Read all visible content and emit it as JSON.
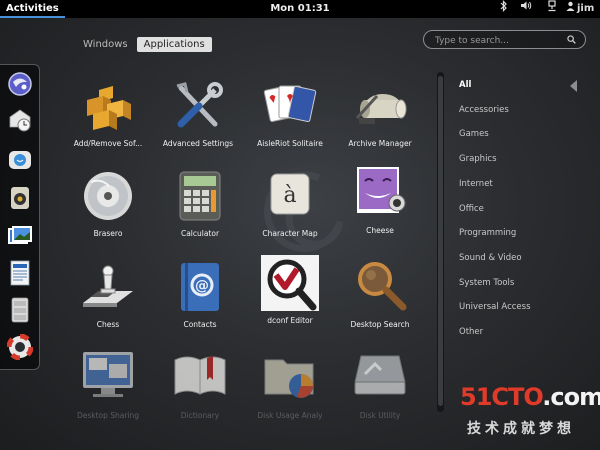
{
  "topbar": {
    "activities_label": "Activities",
    "clock": "Mon 01:31",
    "user": "jim",
    "icons": [
      "bluetooth-icon",
      "volume-icon",
      "network-icon",
      "user-icon"
    ]
  },
  "view_tabs": [
    {
      "label": "Windows",
      "active": false
    },
    {
      "label": "Applications",
      "active": true
    }
  ],
  "search": {
    "placeholder": "Type to search..."
  },
  "dash": {
    "items": [
      "epiphany-browser-icon",
      "evolution-mail-icon",
      "empathy-chat-icon",
      "rhythmbox-icon",
      "shotwell-photos-icon",
      "libreoffice-writer-icon",
      "files-icon",
      "help-icon"
    ]
  },
  "apps": [
    {
      "label": "Add/Remove Sof...",
      "icon": "add-remove-software-icon"
    },
    {
      "label": "Advanced Settings",
      "icon": "advanced-settings-icon"
    },
    {
      "label": "AisleRiot Solitaire",
      "icon": "aisleriot-solitaire-icon"
    },
    {
      "label": "Archive Manager",
      "icon": "archive-manager-icon"
    },
    {
      "label": "Brasero",
      "icon": "brasero-icon"
    },
    {
      "label": "Calculator",
      "icon": "calculator-icon"
    },
    {
      "label": "Character Map",
      "icon": "character-map-icon"
    },
    {
      "label": "Cheese",
      "icon": "cheese-icon"
    },
    {
      "label": "Chess",
      "icon": "chess-icon"
    },
    {
      "label": "Contacts",
      "icon": "contacts-icon"
    },
    {
      "label": "dconf Editor",
      "icon": "dconf-editor-icon"
    },
    {
      "label": "Desktop Search",
      "icon": "desktop-search-icon"
    },
    {
      "label": "Desktop Sharing",
      "icon": "desktop-sharing-icon"
    },
    {
      "label": "Dictionary",
      "icon": "dictionary-icon"
    },
    {
      "label": "Disk Usage Analy",
      "icon": "disk-usage-analyzer-icon"
    },
    {
      "label": "Disk Utility",
      "icon": "disk-utility-icon"
    }
  ],
  "categories": [
    {
      "label": "All",
      "active": true
    },
    {
      "label": "Accessories",
      "active": false
    },
    {
      "label": "Games",
      "active": false
    },
    {
      "label": "Graphics",
      "active": false
    },
    {
      "label": "Internet",
      "active": false
    },
    {
      "label": "Office",
      "active": false
    },
    {
      "label": "Programming",
      "active": false
    },
    {
      "label": "Sound & Video",
      "active": false
    },
    {
      "label": "System Tools",
      "active": false
    },
    {
      "label": "Universal Access",
      "active": false
    },
    {
      "label": "Other",
      "active": false
    }
  ],
  "watermark": {
    "logo_red": "51CTO",
    "logo_white": ".com",
    "tagline": "技术成就梦想"
  },
  "colors": {
    "accent": "#4a90d9",
    "watermark_red": "#e03b2a"
  }
}
